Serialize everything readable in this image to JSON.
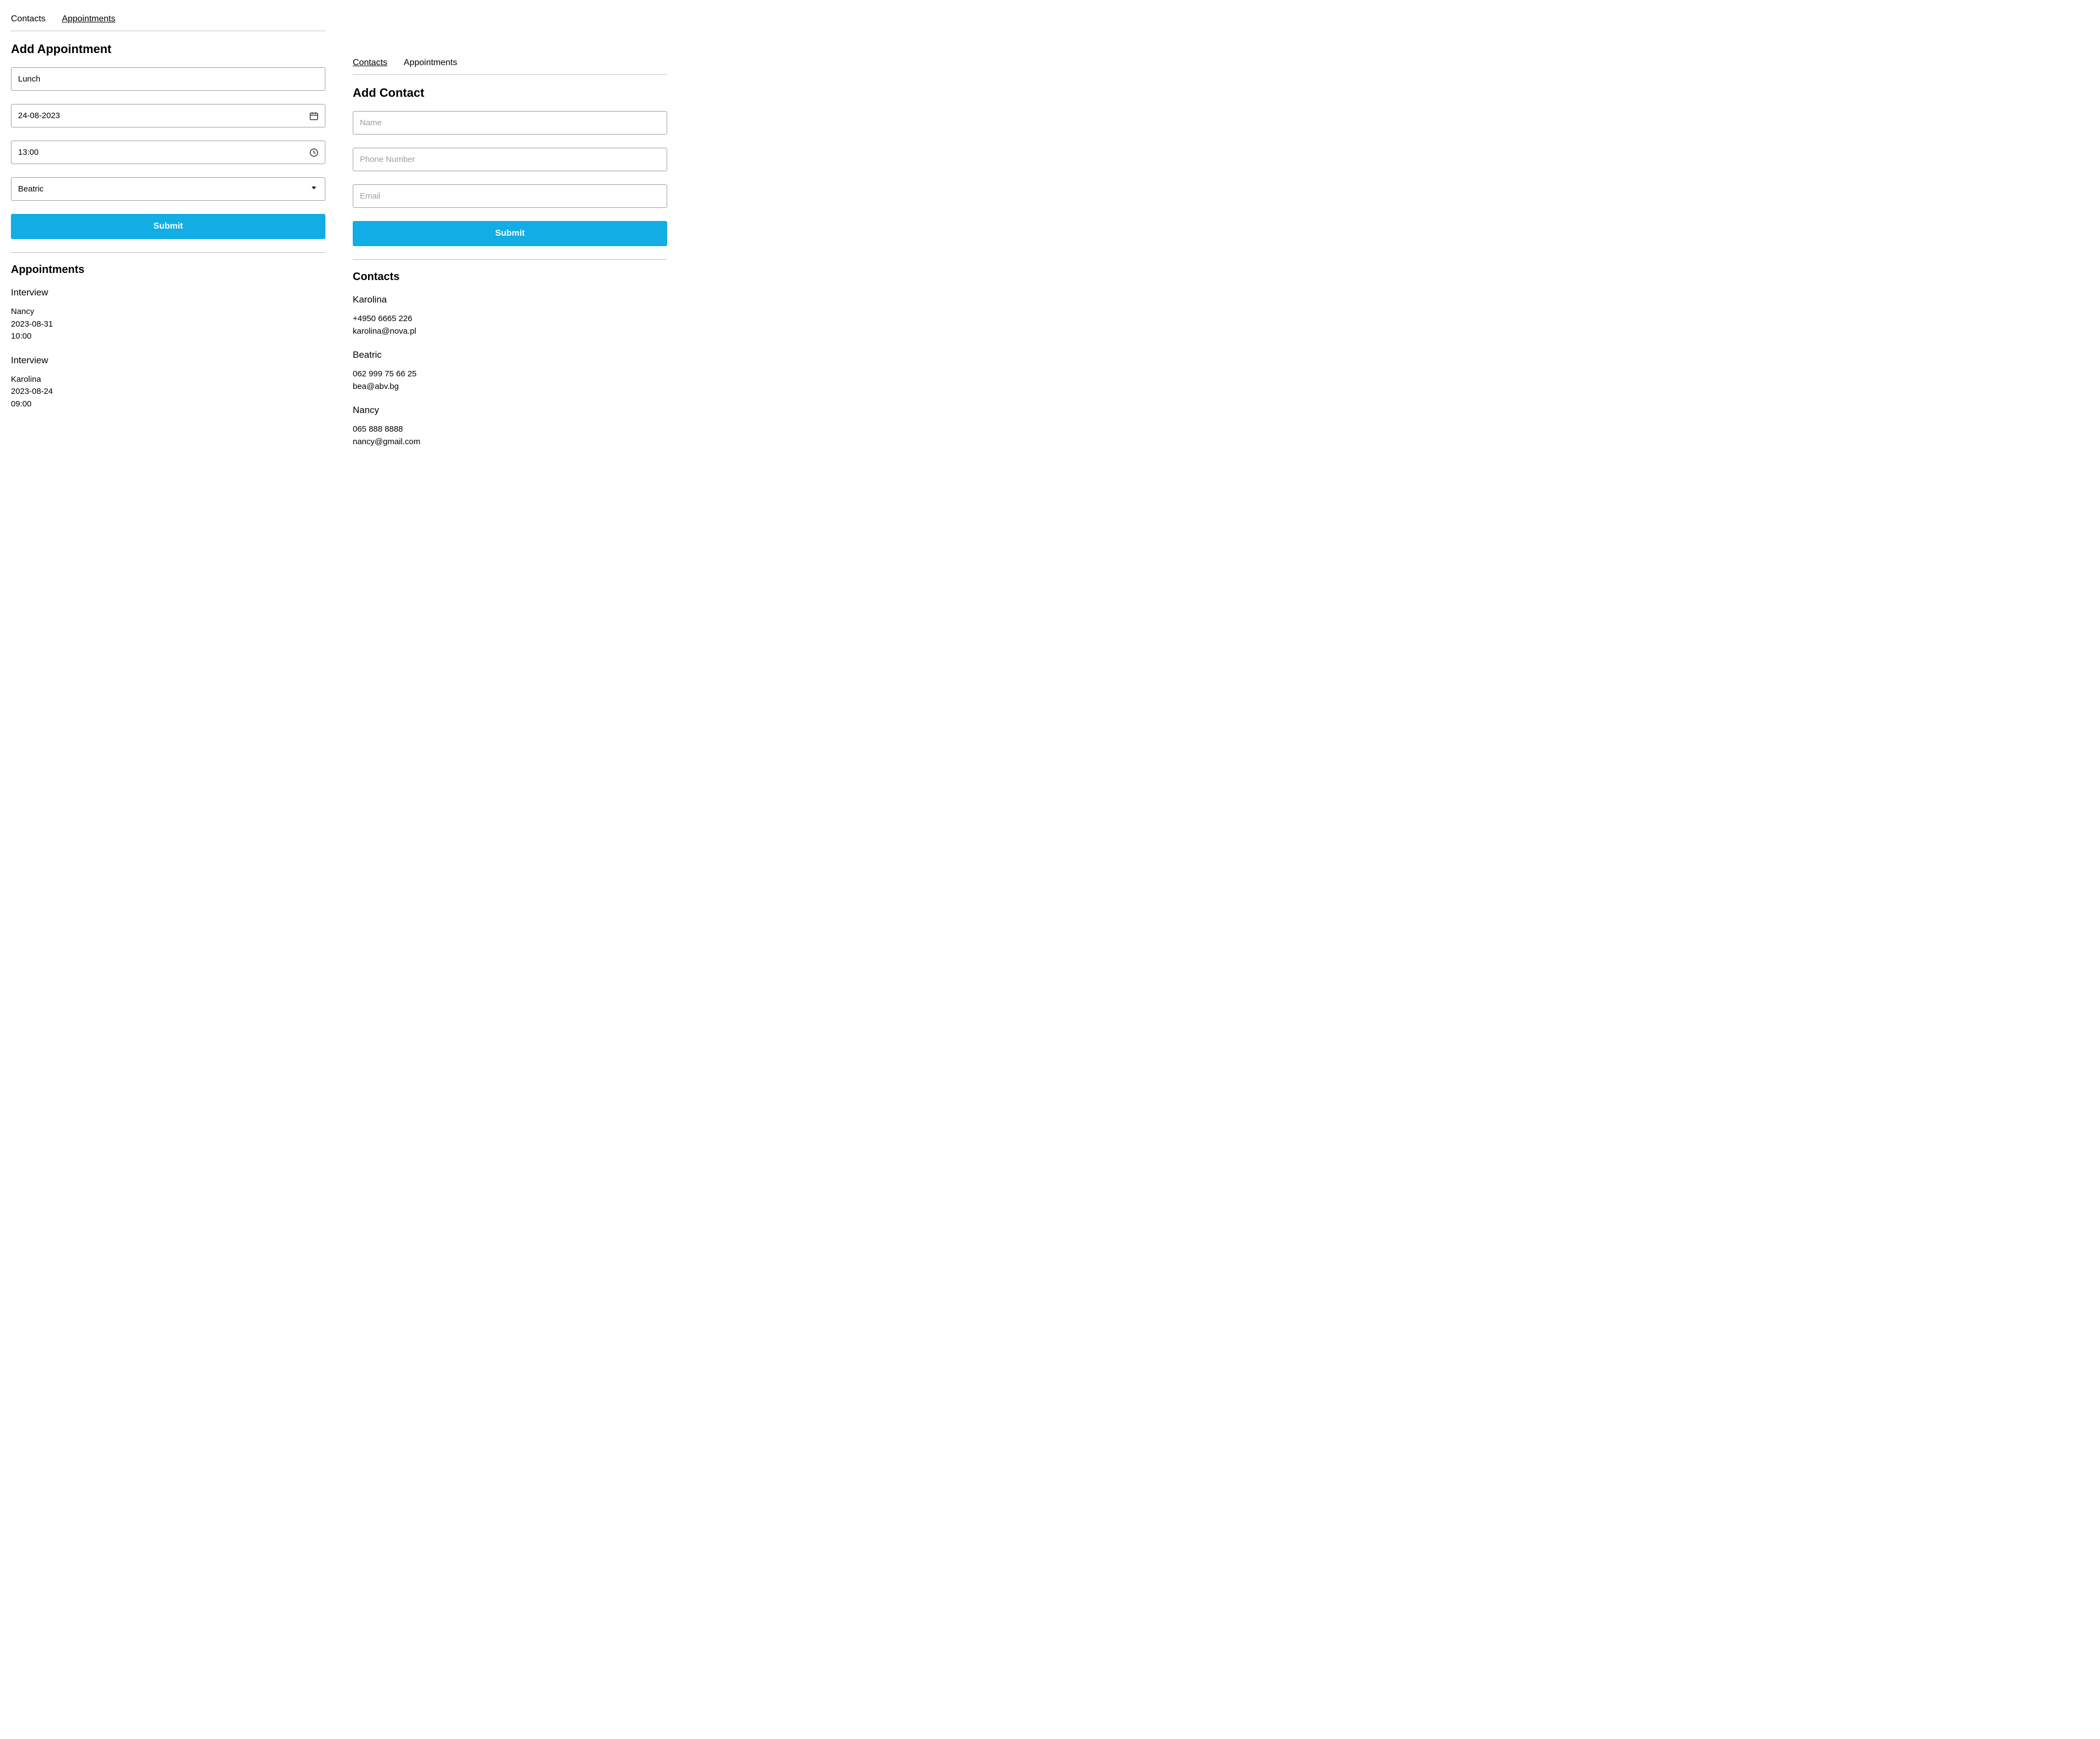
{
  "colors": {
    "accent": "#11ade4",
    "border": "#9e9e9e",
    "placeholder": "#9e9e9e"
  },
  "left": {
    "nav": {
      "contacts": "Contacts",
      "appointments": "Appointments",
      "active": "appointments"
    },
    "form_title": "Add Appointment",
    "fields": {
      "title_value": "Lunch",
      "date_value": "24-08-2023",
      "time_value": "13:00",
      "contact_selected": "Beatric"
    },
    "submit_label": "Submit",
    "list_title": "Appointments",
    "appointments": [
      {
        "title": "Interview",
        "contact": "Nancy",
        "date": "2023-08-31",
        "time": "10:00"
      },
      {
        "title": "Interview",
        "contact": "Karolina",
        "date": "2023-08-24",
        "time": "09:00"
      }
    ]
  },
  "right": {
    "nav": {
      "contacts": "Contacts",
      "appointments": "Appointments",
      "active": "contacts"
    },
    "form_title": "Add Contact",
    "placeholders": {
      "name": "Name",
      "phone": "Phone Number",
      "email": "Email"
    },
    "submit_label": "Submit",
    "list_title": "Contacts",
    "contacts": [
      {
        "name": "Karolina",
        "phone": "+4950 6665 226",
        "email": "karolina@nova.pl"
      },
      {
        "name": "Beatric",
        "phone": "062 999 75 66 25",
        "email": "bea@abv.bg"
      },
      {
        "name": "Nancy",
        "phone": "065 888 8888",
        "email": "nancy@gmail.com"
      }
    ]
  }
}
